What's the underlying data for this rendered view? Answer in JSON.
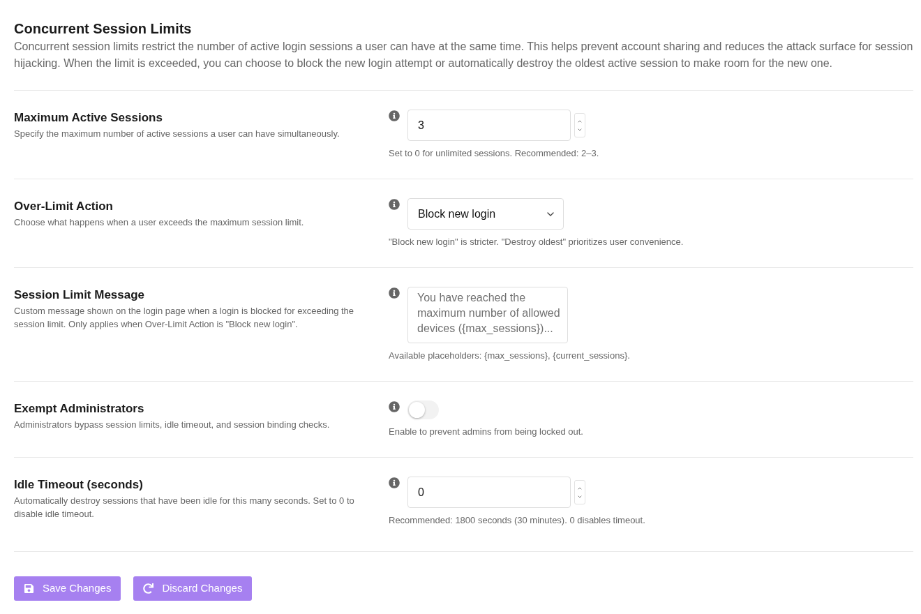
{
  "header": {
    "title": "Concurrent Session Limits",
    "description": "Concurrent session limits restrict the number of active login sessions a user can have at the same time. This helps prevent account sharing and reduces the attack surface for session hijacking. When the limit is exceeded, you can choose to block the new login attempt or automatically destroy the oldest active session to make room for the new one."
  },
  "settings": [
    {
      "kind": "number",
      "label": "Maximum Active Sessions",
      "description": "Specify the maximum number of active sessions a user can have simultaneously.",
      "value": "3",
      "help": "Set to 0 for unlimited sessions. Recommended: 2–3."
    },
    {
      "kind": "select",
      "label": "Over-Limit Action",
      "description": "Choose what happens when a user exceeds the maximum session limit.",
      "value": "Block new login",
      "help": "\"Block new login\" is stricter. \"Destroy oldest\" prioritizes user convenience."
    },
    {
      "kind": "textarea",
      "label": "Session Limit Message",
      "description": "Custom message shown on the login page when a login is blocked for exceeding the session limit. Only applies when Over-Limit Action is \"Block new login\".",
      "placeholder": "You have reached the maximum number of allowed devices ({max_sessions})...",
      "help": "Available placeholders: {max_sessions}, {current_sessions}."
    },
    {
      "kind": "toggle",
      "label": "Exempt Administrators",
      "description": "Administrators bypass session limits, idle timeout, and session binding checks.",
      "on": false,
      "help": "Enable to prevent admins from being locked out."
    },
    {
      "kind": "number",
      "label": "Idle Timeout (seconds)",
      "description": "Automatically destroy sessions that have been idle for this many seconds. Set to 0 to disable idle timeout.",
      "value": "0",
      "help": "Recommended: 1800 seconds (30 minutes). 0 disables timeout."
    }
  ],
  "buttons": [
    {
      "kind": "save",
      "label": "Save Changes"
    },
    {
      "kind": "discard",
      "label": "Discard Changes"
    }
  ]
}
